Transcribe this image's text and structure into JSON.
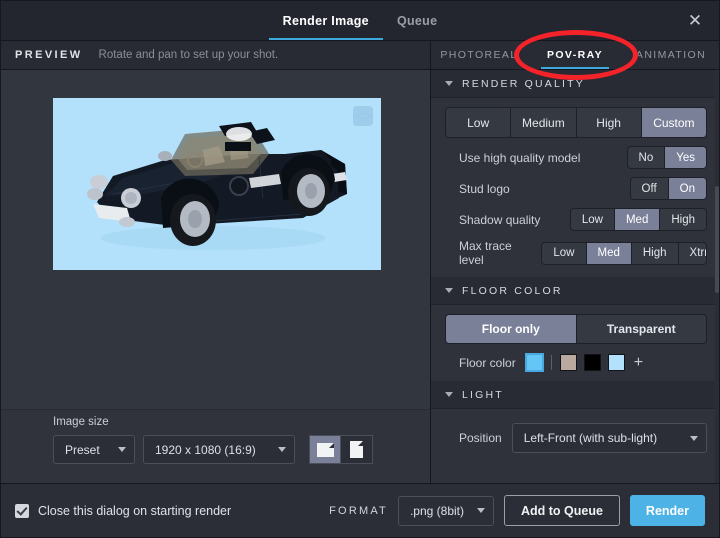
{
  "window": {
    "tabs": [
      {
        "label": "Render Image",
        "active": true
      },
      {
        "label": "Queue",
        "active": false
      }
    ],
    "close_icon": "close-icon"
  },
  "preview": {
    "title": "PREVIEW",
    "hint": "Rotate and pan to set up your shot.",
    "canvas_bg": "#b3e0fa",
    "badge_icon": "fit-view-icon",
    "subject": "LEGO sports car model"
  },
  "mode_tabs": [
    {
      "label": "PHOTOREAL",
      "active": false
    },
    {
      "label": "POV-RAY",
      "active": true
    },
    {
      "label": "ANIMATION",
      "active": false
    }
  ],
  "image_size": {
    "label": "Image size",
    "preset_value": "Preset",
    "resolution_value": "1920 x 1080 (16:9)",
    "orientation": [
      {
        "name": "landscape",
        "selected": true
      },
      {
        "name": "portrait",
        "selected": false
      }
    ]
  },
  "sections": {
    "render_quality": {
      "title": "RENDER QUALITY",
      "presets": [
        {
          "label": "Low",
          "selected": false
        },
        {
          "label": "Medium",
          "selected": false
        },
        {
          "label": "High",
          "selected": false
        },
        {
          "label": "Custom",
          "selected": true
        }
      ],
      "options": [
        {
          "label": "Use high quality model",
          "choices": [
            {
              "label": "No",
              "selected": false
            },
            {
              "label": "Yes",
              "selected": true
            }
          ]
        },
        {
          "label": "Stud logo",
          "choices": [
            {
              "label": "Off",
              "selected": false
            },
            {
              "label": "On",
              "selected": true
            }
          ]
        },
        {
          "label": "Shadow quality",
          "choices": [
            {
              "label": "Low",
              "selected": false
            },
            {
              "label": "Med",
              "selected": true
            },
            {
              "label": "High",
              "selected": false
            }
          ]
        },
        {
          "label": "Max trace level",
          "choices": [
            {
              "label": "Low",
              "selected": false
            },
            {
              "label": "Med",
              "selected": true
            },
            {
              "label": "High",
              "selected": false
            },
            {
              "label": "Xtrm",
              "selected": false
            }
          ]
        }
      ]
    },
    "floor_color": {
      "title": "FLOOR COLOR",
      "modes": [
        {
          "label": "Floor only",
          "selected": true
        },
        {
          "label": "Transparent",
          "selected": false
        }
      ],
      "swatch_label": "Floor color",
      "current_swatch": "#63c6f5",
      "swatches": [
        {
          "color": "#b9a99f",
          "selected": false
        },
        {
          "color": "#000000",
          "selected": false
        },
        {
          "color": "#b3e0fa",
          "selected": false
        }
      ],
      "add_label": "+"
    },
    "light": {
      "title": "LIGHT",
      "position_label": "Position",
      "position_value": "Left-Front (with sub-light)"
    }
  },
  "footer": {
    "close_on_render_label": "Close this dialog on starting render",
    "close_on_render_checked": true,
    "format_label": "FORMAT",
    "format_value": ".png (8bit)",
    "add_to_queue_label": "Add to Queue",
    "render_label": "Render",
    "render_accent": "#4db2e6"
  },
  "annotation": {
    "shape": "red-ellipse",
    "color": "#f4232a",
    "target": "POV-RAY"
  }
}
